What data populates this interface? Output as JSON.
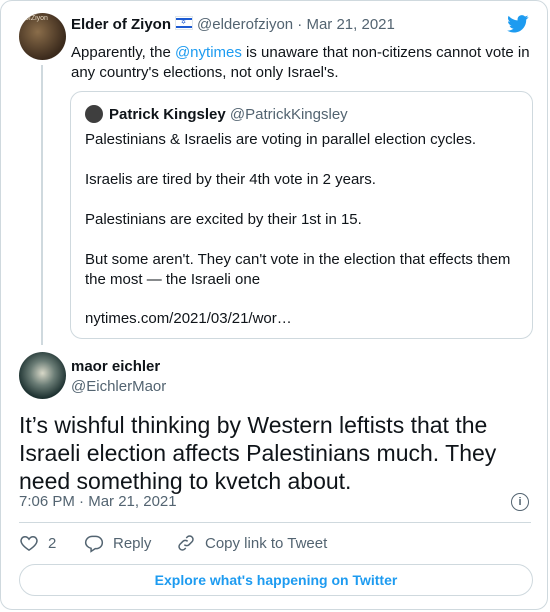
{
  "author": {
    "name": "Elder of Ziyon",
    "handle": "@elderofziyon",
    "separator": "·",
    "date": "Mar 21, 2021",
    "avatar_text": "ofZiyon",
    "text_before": "Apparently, the ",
    "mention": "@nytimes",
    "text_after": " is unaware that non-citizens cannot vote in any country's elections, not only Israel's."
  },
  "quoted": {
    "name": "Patrick Kingsley",
    "handle": "@PatrickKingsley",
    "paragraphs": [
      "Palestinians & Israelis are voting in parallel election cycles.",
      "Israelis are tired by their 4th vote in 2 years.",
      "Palestinians are excited by their 1st in 15.",
      "But some aren't. They can't vote in the election that effects them the most — the Israeli one"
    ],
    "link": "nytimes.com/2021/03/21/wor…"
  },
  "reply": {
    "name": "maor eichler",
    "handle": "@EichlerMaor",
    "text": "It’s wishful thinking by Western leftists that the Israeli election affects Palestinians much. They need something to kvetch about.",
    "time": "7:06 PM",
    "separator": "·",
    "date": "Mar 21, 2021"
  },
  "actions": {
    "like_count": "2",
    "reply_label": "Reply",
    "copy_label": "Copy link to Tweet"
  },
  "explore_label": "Explore what's happening on Twitter",
  "colors": {
    "accent": "#1d9bf0",
    "text": "#0f1419",
    "muted": "#536471",
    "border": "#cfd9de"
  },
  "icons": [
    "twitter-bird-icon",
    "israel-flag-icon",
    "info-icon",
    "heart-icon",
    "reply-icon",
    "link-icon"
  ]
}
